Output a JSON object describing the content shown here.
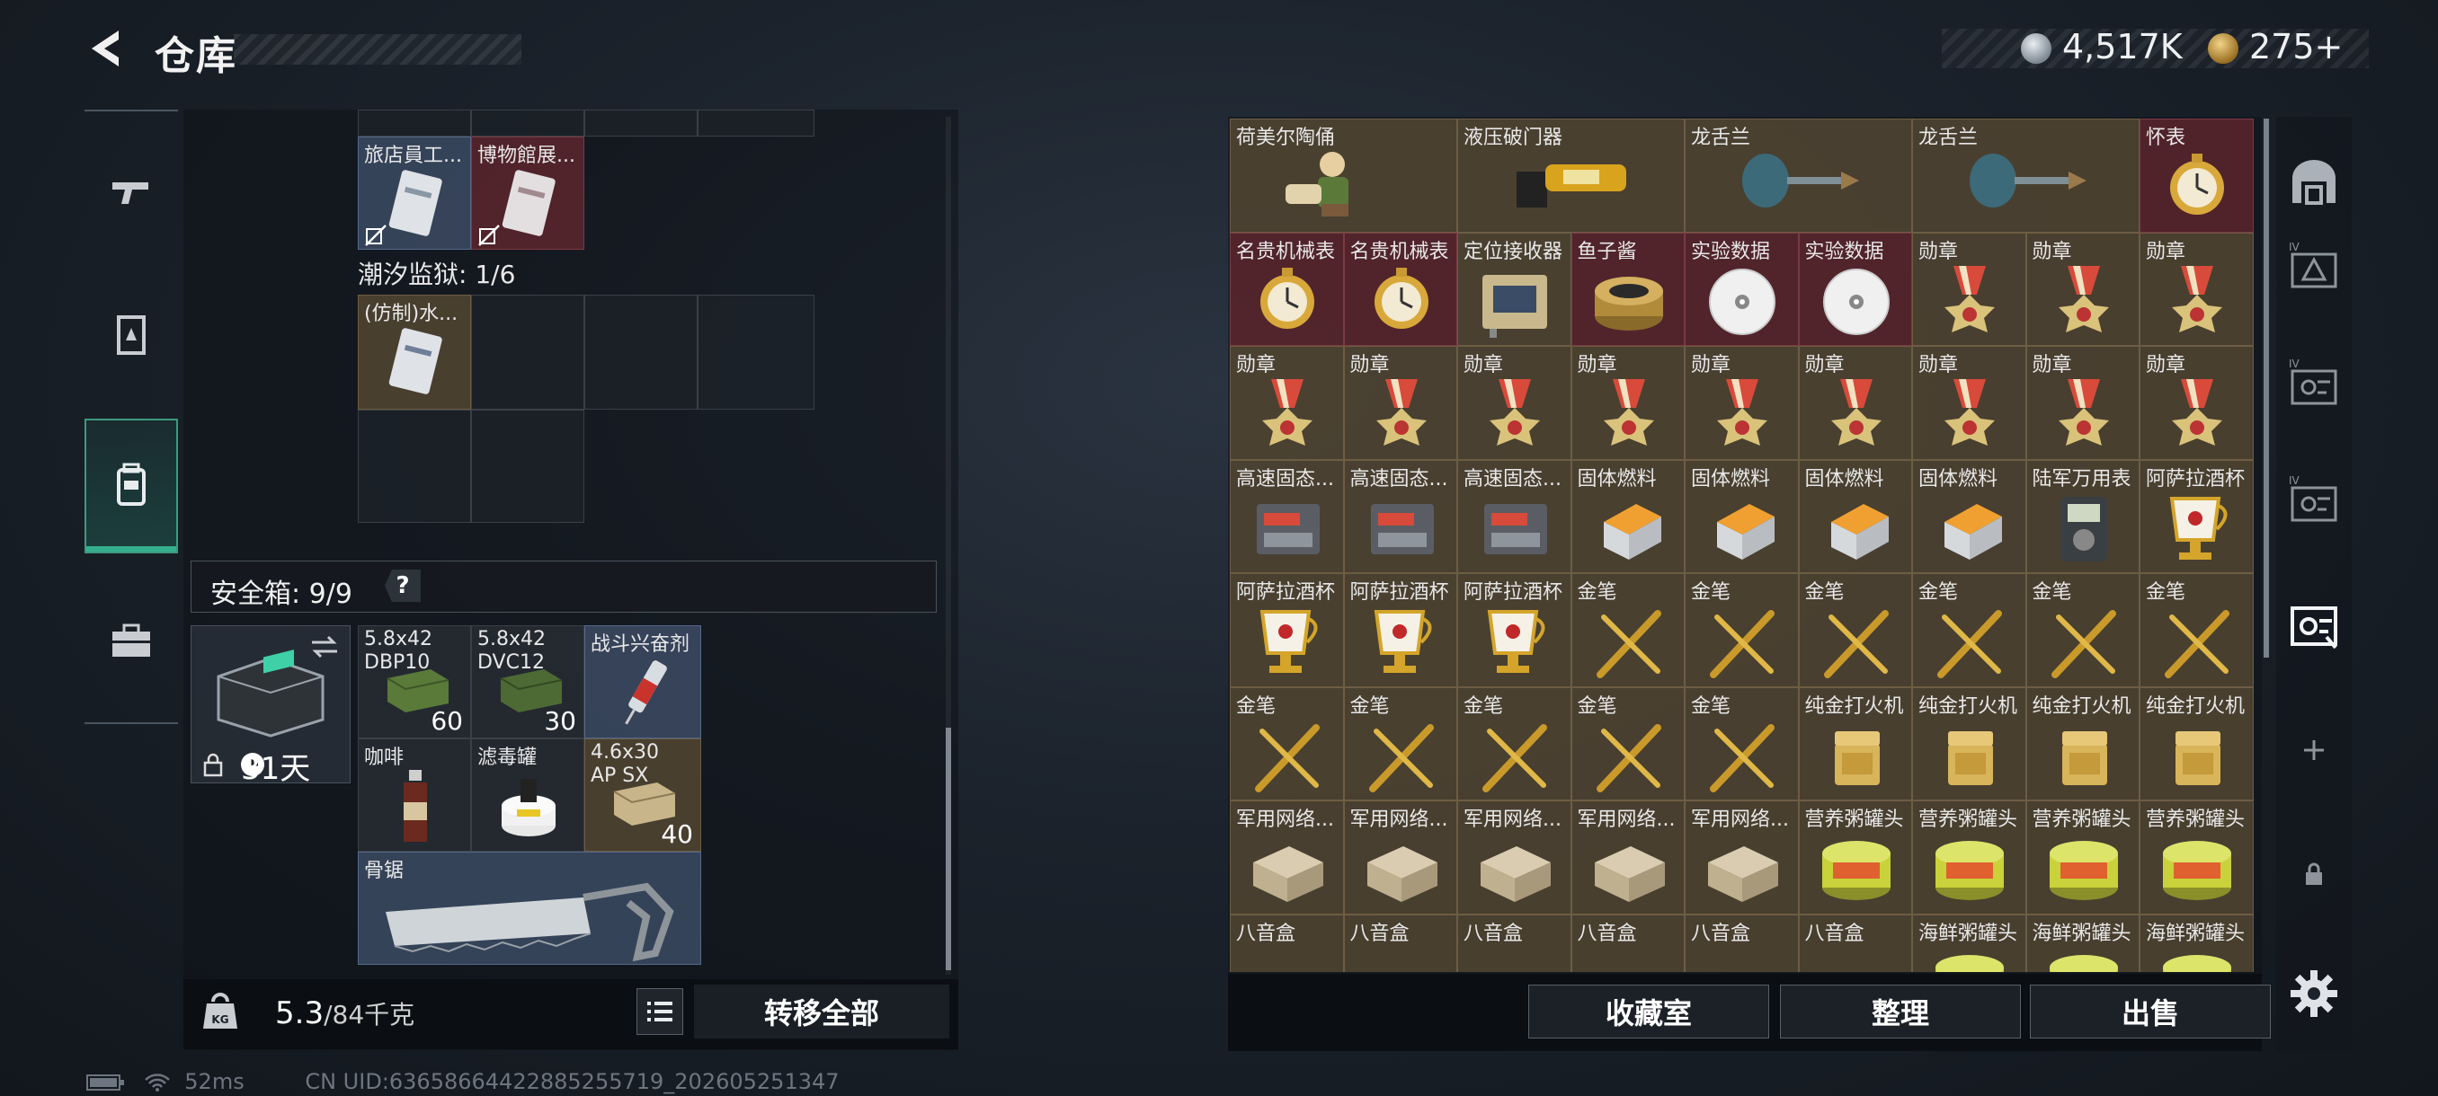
{
  "header": {
    "title": "仓库",
    "coins": "4,517K",
    "gems": "275+"
  },
  "left_nav": [
    "weapons",
    "armor",
    "backpack",
    "toolbox"
  ],
  "backpack": {
    "section_label": "潮汐监狱: 1/6",
    "top_items": [
      {
        "name": "旅店員工...",
        "color": "blue"
      },
      {
        "name": "博物館展...",
        "color": "red"
      }
    ],
    "mid_items": [
      {
        "name": "(仿制)水...",
        "color": "gold"
      }
    ],
    "safebox": {
      "label": "安全箱: 9/9",
      "help": "?",
      "days": "31天"
    },
    "safe_items": [
      {
        "name": "5.8x42 DBP10",
        "count": "60"
      },
      {
        "name": "5.8x42 DVC12",
        "count": "30"
      },
      {
        "name": "战斗兴奋剂",
        "count": ""
      },
      {
        "name": "咖啡",
        "count": ""
      },
      {
        "name": "滤毒罐",
        "count": ""
      },
      {
        "name": "4.6x30 AP SX",
        "count": "40"
      },
      {
        "name": "骨锯",
        "count": ""
      }
    ],
    "weight": "5.3",
    "weight_max": "/84千克",
    "transfer_all": "转移全部"
  },
  "stash": {
    "rows": [
      [
        {
          "n": "荷美尔陶俑",
          "w": 2,
          "c": "gold",
          "i": "figurine"
        },
        {
          "n": "液压破门器",
          "w": 2,
          "c": "gold",
          "i": "breacher"
        },
        {
          "n": "龙舌兰",
          "w": 2,
          "c": "gold",
          "i": "bottle"
        },
        {
          "n": "龙舌兰",
          "w": 2,
          "c": "gold",
          "i": "bottle"
        },
        {
          "n": "怀表",
          "w": 1,
          "c": "red",
          "i": "watch"
        }
      ],
      [
        {
          "n": "名贵机械表",
          "w": 1,
          "c": "red",
          "i": "watch"
        },
        {
          "n": "名贵机械表",
          "w": 1,
          "c": "red",
          "i": "watch"
        },
        {
          "n": "定位接收器",
          "w": 1,
          "c": "gold",
          "i": "device"
        },
        {
          "n": "鱼子酱",
          "w": 1,
          "c": "red",
          "i": "tin"
        },
        {
          "n": "实验数据",
          "w": 1,
          "c": "red",
          "i": "disc"
        },
        {
          "n": "实验数据",
          "w": 1,
          "c": "red",
          "i": "disc"
        },
        {
          "n": "勋章",
          "w": 1,
          "c": "gold",
          "i": "medal"
        },
        {
          "n": "勋章",
          "w": 1,
          "c": "gold",
          "i": "medal"
        },
        {
          "n": "勋章",
          "w": 1,
          "c": "gold",
          "i": "medal"
        }
      ],
      [
        {
          "n": "勋章",
          "w": 1,
          "c": "gold",
          "i": "medal"
        },
        {
          "n": "勋章",
          "w": 1,
          "c": "gold",
          "i": "medal"
        },
        {
          "n": "勋章",
          "w": 1,
          "c": "gold",
          "i": "medal"
        },
        {
          "n": "勋章",
          "w": 1,
          "c": "gold",
          "i": "medal"
        },
        {
          "n": "勋章",
          "w": 1,
          "c": "gold",
          "i": "medal"
        },
        {
          "n": "勋章",
          "w": 1,
          "c": "gold",
          "i": "medal"
        },
        {
          "n": "勋章",
          "w": 1,
          "c": "gold",
          "i": "medal"
        },
        {
          "n": "勋章",
          "w": 1,
          "c": "gold",
          "i": "medal"
        },
        {
          "n": "勋章",
          "w": 1,
          "c": "gold",
          "i": "medal"
        }
      ],
      [
        {
          "n": "高速固态...",
          "w": 1,
          "c": "gold",
          "i": "ssd"
        },
        {
          "n": "高速固态...",
          "w": 1,
          "c": "gold",
          "i": "ssd"
        },
        {
          "n": "高速固态...",
          "w": 1,
          "c": "gold",
          "i": "ssd"
        },
        {
          "n": "固体燃料",
          "w": 1,
          "c": "gold",
          "i": "fuel"
        },
        {
          "n": "固体燃料",
          "w": 1,
          "c": "gold",
          "i": "fuel"
        },
        {
          "n": "固体燃料",
          "w": 1,
          "c": "gold",
          "i": "fuel"
        },
        {
          "n": "固体燃料",
          "w": 1,
          "c": "gold",
          "i": "fuel"
        },
        {
          "n": "陆军万用表",
          "w": 1,
          "c": "gold",
          "i": "meter"
        },
        {
          "n": "阿萨拉酒杯",
          "w": 1,
          "c": "gold",
          "i": "cup"
        }
      ],
      [
        {
          "n": "阿萨拉酒杯",
          "w": 1,
          "c": "gold",
          "i": "cup"
        },
        {
          "n": "阿萨拉酒杯",
          "w": 1,
          "c": "gold",
          "i": "cup"
        },
        {
          "n": "阿萨拉酒杯",
          "w": 1,
          "c": "gold",
          "i": "cup"
        },
        {
          "n": "金笔",
          "w": 1,
          "c": "gold",
          "i": "pen"
        },
        {
          "n": "金笔",
          "w": 1,
          "c": "gold",
          "i": "pen"
        },
        {
          "n": "金笔",
          "w": 1,
          "c": "gold",
          "i": "pen"
        },
        {
          "n": "金笔",
          "w": 1,
          "c": "gold",
          "i": "pen"
        },
        {
          "n": "金笔",
          "w": 1,
          "c": "gold",
          "i": "pen"
        },
        {
          "n": "金笔",
          "w": 1,
          "c": "gold",
          "i": "pen"
        }
      ],
      [
        {
          "n": "金笔",
          "w": 1,
          "c": "gold",
          "i": "pen"
        },
        {
          "n": "金笔",
          "w": 1,
          "c": "gold",
          "i": "pen"
        },
        {
          "n": "金笔",
          "w": 1,
          "c": "gold",
          "i": "pen"
        },
        {
          "n": "金笔",
          "w": 1,
          "c": "gold",
          "i": "pen"
        },
        {
          "n": "金笔",
          "w": 1,
          "c": "gold",
          "i": "pen"
        },
        {
          "n": "纯金打火机",
          "w": 1,
          "c": "gold",
          "i": "lighter"
        },
        {
          "n": "纯金打火机",
          "w": 1,
          "c": "gold",
          "i": "lighter"
        },
        {
          "n": "纯金打火机",
          "w": 1,
          "c": "gold",
          "i": "lighter"
        },
        {
          "n": "纯金打火机",
          "w": 1,
          "c": "gold",
          "i": "lighter"
        }
      ],
      [
        {
          "n": "军用网络...",
          "w": 1,
          "c": "gold",
          "i": "router"
        },
        {
          "n": "军用网络...",
          "w": 1,
          "c": "gold",
          "i": "router"
        },
        {
          "n": "军用网络...",
          "w": 1,
          "c": "gold",
          "i": "router"
        },
        {
          "n": "军用网络...",
          "w": 1,
          "c": "gold",
          "i": "router"
        },
        {
          "n": "军用网络...",
          "w": 1,
          "c": "gold",
          "i": "router"
        },
        {
          "n": "营养粥罐头",
          "w": 1,
          "c": "gold",
          "i": "can"
        },
        {
          "n": "营养粥罐头",
          "w": 1,
          "c": "gold",
          "i": "can"
        },
        {
          "n": "营养粥罐头",
          "w": 1,
          "c": "gold",
          "i": "can"
        },
        {
          "n": "营养粥罐头",
          "w": 1,
          "c": "gold",
          "i": "can"
        }
      ],
      [
        {
          "n": "八音盒",
          "w": 1,
          "c": "gold",
          "i": "box"
        },
        {
          "n": "八音盒",
          "w": 1,
          "c": "gold",
          "i": "box"
        },
        {
          "n": "八音盒",
          "w": 1,
          "c": "gold",
          "i": "box"
        },
        {
          "n": "八音盒",
          "w": 1,
          "c": "gold",
          "i": "box"
        },
        {
          "n": "八音盒",
          "w": 1,
          "c": "gold",
          "i": "box"
        },
        {
          "n": "八音盒",
          "w": 1,
          "c": "gold",
          "i": "box"
        },
        {
          "n": "海鲜粥罐头",
          "w": 1,
          "c": "gold",
          "i": "can"
        },
        {
          "n": "海鲜粥罐头",
          "w": 1,
          "c": "gold",
          "i": "can"
        },
        {
          "n": "海鲜粥罐头",
          "w": 1,
          "c": "gold",
          "i": "can"
        }
      ]
    ],
    "buttons": {
      "collection": "收藏室",
      "sort": "整理",
      "sell": "出售"
    }
  },
  "status": {
    "ping": "52ms",
    "uid": "CN UID:63658664422885255719_202605251347"
  },
  "colors": {
    "accent": "#35b08f",
    "gold_cell": "#52463a",
    "red_cell": "#5c262d",
    "blue_cell": "#3c4b64"
  }
}
